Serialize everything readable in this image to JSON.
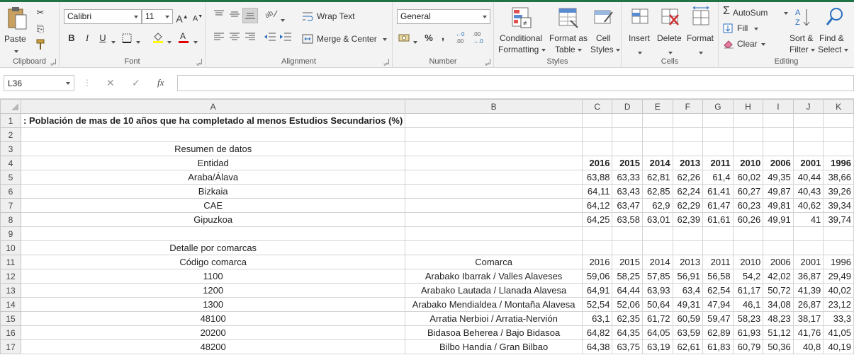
{
  "ribbon": {
    "clipboard": {
      "paste": "Paste",
      "group": "Clipboard"
    },
    "font": {
      "name": "Calibri",
      "size": "11",
      "bold": "B",
      "italic": "I",
      "underline": "U",
      "grow": "A",
      "shrink": "A",
      "group": "Font"
    },
    "alignment": {
      "wrap": "Wrap Text",
      "merge": "Merge & Center",
      "group": "Alignment"
    },
    "number": {
      "format": "General",
      "percent": "%",
      "comma": ",",
      "group": "Number"
    },
    "styles": {
      "conditional1": "Conditional",
      "conditional2": "Formatting",
      "table1": "Format as",
      "table2": "Table",
      "cell1": "Cell",
      "cell2": "Styles",
      "group": "Styles"
    },
    "cells": {
      "insert": "Insert",
      "delete": "Delete",
      "format": "Format",
      "group": "Cells"
    },
    "editing": {
      "autosum": "AutoSum",
      "fill": "Fill",
      "clear": "Clear",
      "sort1": "Sort &",
      "sort2": "Filter",
      "find1": "Find &",
      "find2": "Select",
      "group": "Editing"
    }
  },
  "formula_bar": {
    "name_box": "L36",
    "cancel": "✕",
    "enter": "✓",
    "fx": "fx",
    "formula": ""
  },
  "columns": [
    "A",
    "B",
    "C",
    "D",
    "E",
    "F",
    "G",
    "H",
    "I",
    "J",
    "K"
  ],
  "rows": [
    {
      "n": "1",
      "cells": [
        ": Población de mas de 10 años que ha completado al menos Estudios Secundarios (%)",
        "",
        "",
        "",
        "",
        "",
        "",
        "",
        "",
        "",
        ""
      ]
    },
    {
      "n": "2",
      "cells": [
        "",
        "",
        "",
        "",
        "",
        "",
        "",
        "",
        "",
        "",
        ""
      ]
    },
    {
      "n": "3",
      "cells": [
        "Resumen de datos",
        "",
        "",
        "",
        "",
        "",
        "",
        "",
        "",
        "",
        ""
      ]
    },
    {
      "n": "4",
      "cells": [
        "Entidad",
        "",
        "2016",
        "2015",
        "2014",
        "2013",
        "2011",
        "2010",
        "2006",
        "2001",
        "1996"
      ]
    },
    {
      "n": "5",
      "cells": [
        "Araba/Álava",
        "",
        "63,88",
        "63,33",
        "62,81",
        "62,26",
        "61,4",
        "60,02",
        "49,35",
        "40,44",
        "38,66"
      ]
    },
    {
      "n": "6",
      "cells": [
        "Bizkaia",
        "",
        "64,11",
        "63,43",
        "62,85",
        "62,24",
        "61,41",
        "60,27",
        "49,87",
        "40,43",
        "39,26"
      ]
    },
    {
      "n": "7",
      "cells": [
        "CAE",
        "",
        "64,12",
        "63,47",
        "62,9",
        "62,29",
        "61,47",
        "60,23",
        "49,81",
        "40,62",
        "39,34"
      ]
    },
    {
      "n": "8",
      "cells": [
        "Gipuzkoa",
        "",
        "64,25",
        "63,58",
        "63,01",
        "62,39",
        "61,61",
        "60,26",
        "49,91",
        "41",
        "39,74"
      ]
    },
    {
      "n": "9",
      "cells": [
        "",
        "",
        "",
        "",
        "",
        "",
        "",
        "",
        "",
        "",
        ""
      ]
    },
    {
      "n": "10",
      "cells": [
        "Detalle por comarcas",
        "",
        "",
        "",
        "",
        "",
        "",
        "",
        "",
        "",
        ""
      ]
    },
    {
      "n": "11",
      "cells": [
        "Código comarca",
        "Comarca",
        "2016",
        "2015",
        "2014",
        "2013",
        "2011",
        "2010",
        "2006",
        "2001",
        "1996"
      ]
    },
    {
      "n": "12",
      "cells": [
        "1100",
        "Arabako Ibarrak / Valles Alaveses",
        "59,06",
        "58,25",
        "57,85",
        "56,91",
        "56,58",
        "54,2",
        "42,02",
        "36,87",
        "29,49"
      ]
    },
    {
      "n": "13",
      "cells": [
        "1200",
        "Arabako Lautada / Llanada Alavesa",
        "64,91",
        "64,44",
        "63,93",
        "63,4",
        "62,54",
        "61,17",
        "50,72",
        "41,39",
        "40,02"
      ]
    },
    {
      "n": "14",
      "cells": [
        "1300",
        "Arabako Mendialdea / Montaña Alavesa",
        "52,54",
        "52,06",
        "50,64",
        "49,31",
        "47,94",
        "46,1",
        "34,08",
        "26,87",
        "23,12"
      ]
    },
    {
      "n": "15",
      "cells": [
        "48100",
        "Arratia Nerbioi / Arratia-Nervión",
        "63,1",
        "62,35",
        "61,72",
        "60,59",
        "59,47",
        "58,23",
        "48,23",
        "38,17",
        "33,3"
      ]
    },
    {
      "n": "16",
      "cells": [
        "20200",
        "Bidasoa Beherea / Bajo Bidasoa",
        "64,82",
        "64,35",
        "64,05",
        "63,59",
        "62,89",
        "61,93",
        "51,12",
        "41,76",
        "41,05"
      ]
    },
    {
      "n": "17",
      "cells": [
        "48200",
        "Bilbo Handia / Gran Bilbao",
        "64,38",
        "63,75",
        "63,19",
        "62,61",
        "61,83",
        "60,79",
        "50,36",
        "40,8",
        "40,19"
      ]
    }
  ]
}
